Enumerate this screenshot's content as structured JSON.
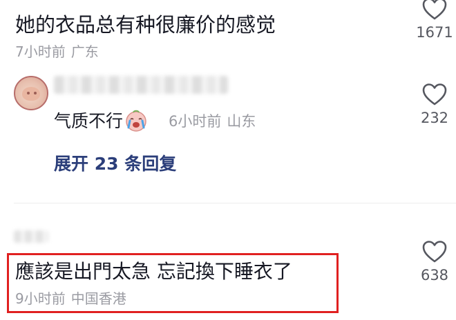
{
  "comments": [
    {
      "text": "她的衣品总有种很廉价的感觉",
      "time": "7小时前",
      "region": "广东",
      "likes": "1671"
    },
    {
      "text": "應該是出門太急 忘記換下睡衣了",
      "time": "9小时前",
      "region": "中国香港",
      "likes": "638"
    }
  ],
  "reply": {
    "text": "气质不行",
    "emoji": "crying-face",
    "time": "6小时前",
    "region": "山东",
    "likes": "232"
  },
  "expand_label": "展开 23 条回复",
  "colors": {
    "text": "#161823",
    "meta": "#9a9ba2",
    "link": "#2b3e7a",
    "highlight": "#e02020"
  }
}
